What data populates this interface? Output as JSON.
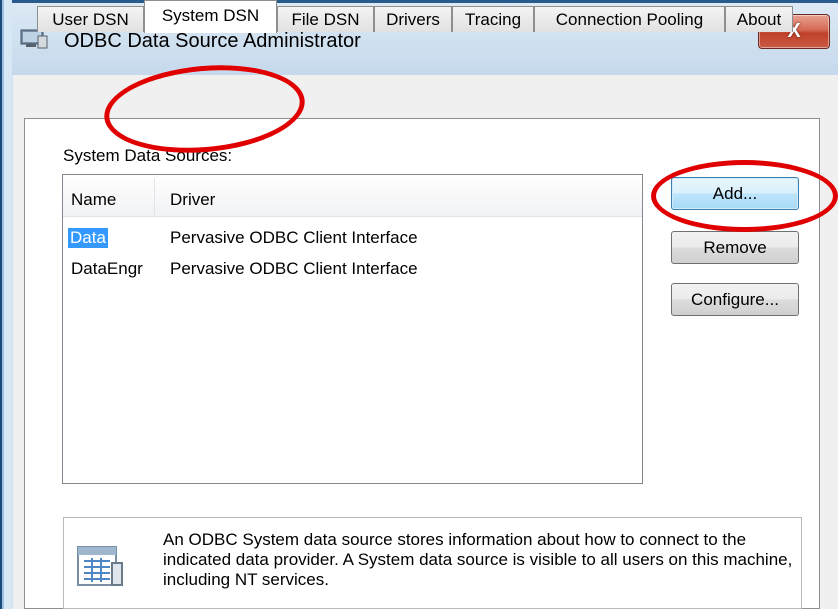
{
  "window": {
    "title": "ODBC Data Source Administrator",
    "close_label": "X"
  },
  "tabs": [
    {
      "label": "User DSN",
      "active": false
    },
    {
      "label": "System DSN",
      "active": true
    },
    {
      "label": "File DSN",
      "active": false
    },
    {
      "label": "Drivers",
      "active": false
    },
    {
      "label": "Tracing",
      "active": false
    },
    {
      "label": "Connection Pooling",
      "active": false
    },
    {
      "label": "About",
      "active": false
    }
  ],
  "panel": {
    "group_label": "System Data Sources:",
    "columns": [
      "Name",
      "Driver"
    ],
    "rows": [
      {
        "name": "Data",
        "driver": "Pervasive ODBC Client Interface",
        "selected": true
      },
      {
        "name": "DataEngr",
        "driver": "Pervasive ODBC Client Interface",
        "selected": false
      }
    ],
    "buttons": {
      "add": "Add...",
      "remove": "Remove",
      "configure": "Configure..."
    },
    "info_text": "An ODBC System data source stores information about how to connect to the indicated data provider.  A System data source is visible to all users on this machine, including NT services."
  },
  "icons": {
    "app": "odbc-admin-icon",
    "info": "data-source-icon"
  },
  "colors": {
    "annotation": "#e00000",
    "selection": "#3399ff",
    "close": "#c0412b"
  }
}
